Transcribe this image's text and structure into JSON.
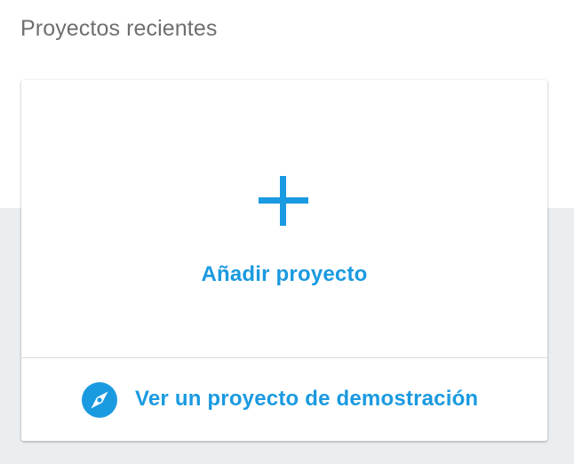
{
  "recent_projects": {
    "title": "Proyectos recientes",
    "add_project_label": "Añadir proyecto",
    "demo_link_label": "Ver un proyecto de demostración"
  },
  "icons": {
    "add": "plus-icon",
    "demo": "compass-icon"
  },
  "colors": {
    "accent": "#1a9ae0",
    "title_text": "#6f6f6f",
    "page_background_lower": "#ebeef1",
    "card_background": "#ffffff",
    "divider": "#dcdcdc"
  }
}
